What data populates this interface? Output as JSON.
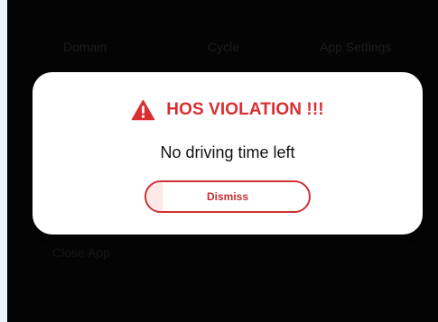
{
  "background": {
    "screen_color": "#050505",
    "outer_color": "#e8f6fc"
  },
  "status_row": {
    "items": [
      "",
      "",
      ""
    ]
  },
  "menu": {
    "domain_label": "Domain",
    "cycle_label": "Cycle",
    "settings_label": "App Settings"
  },
  "footer": {
    "close_app_label": "Close App"
  },
  "dialog": {
    "title": "HOS VIOLATION !!!",
    "message": "No driving time left",
    "dismiss_label": "Dismiss",
    "warning_icon": "warning-triangle-icon",
    "accent_color": "#d92f32"
  }
}
